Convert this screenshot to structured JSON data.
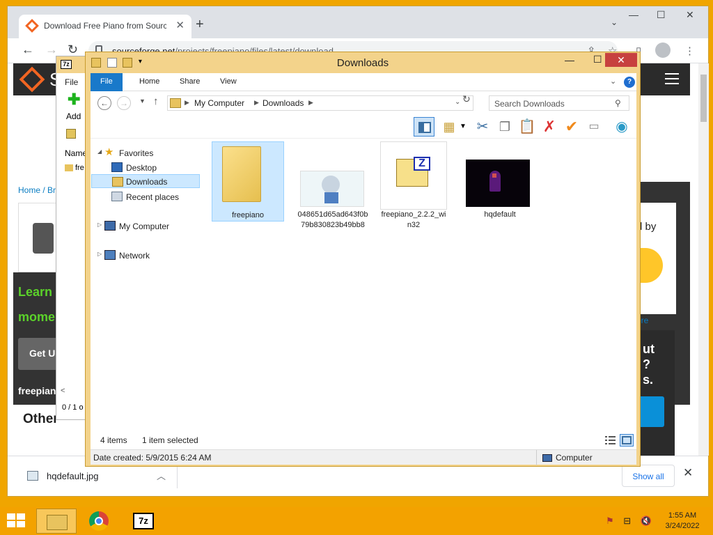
{
  "browser": {
    "tab_title": "Download Free Piano from Sourc",
    "tab_close": "✕",
    "new_tab": "+",
    "url_domain": "sourceforge.net",
    "url_path": "/projects/freepiano/files/latest/download",
    "window_controls": {
      "minimize": "—",
      "maximize": "☐",
      "close": "✕"
    }
  },
  "page": {
    "brand_letter": "S",
    "breadcrumb": "Home / Br",
    "learn_text": "Learn",
    "mome_text": "mome",
    "get_button": "Get U",
    "freepiano_text": "freepian",
    "other_heading": "Other",
    "byline": "d by",
    "more_link": "ore",
    "right_promo": "ut\n?\ns."
  },
  "downloads_bar": {
    "file_name": "hqdefault.jpg",
    "show_all": "Show all",
    "close": "✕"
  },
  "zip_window": {
    "file_menu": "File",
    "add_label": "Add",
    "name_header": "Name",
    "row_item": "fre",
    "status": "0 / 1 o"
  },
  "explorer": {
    "title": "Downloads",
    "ribbon_tabs": [
      "File",
      "Home",
      "Share",
      "View"
    ],
    "help": "?",
    "breadcrumb": [
      "My Computer",
      "Downloads"
    ],
    "search_placeholder": "Search Downloads",
    "nav": {
      "favorites": "Favorites",
      "desktop": "Desktop",
      "downloads": "Downloads",
      "recent": "Recent places",
      "my_computer": "My Computer",
      "network": "Network"
    },
    "items": [
      {
        "name": "freepiano",
        "type": "folder"
      },
      {
        "name": "048651d65ad643f0b79b830823b49bb8",
        "type": "image"
      },
      {
        "name": "freepiano_2.2.2_win32",
        "type": "zip"
      },
      {
        "name": "hqdefault",
        "type": "image"
      }
    ],
    "status_count": "4 items",
    "status_selected": "1 item selected",
    "date_created": "Date created: 5/9/2015 6:24 AM",
    "computer_label": "Computer"
  },
  "taskbar": {
    "time": "1:55 AM",
    "date": "3/24/2022",
    "sevenzip_label": "7z"
  },
  "colors": {
    "accent": "#f0a500",
    "selection": "#cce8ff",
    "ribbon_file": "#1979ca",
    "close_red": "#c7413f"
  }
}
